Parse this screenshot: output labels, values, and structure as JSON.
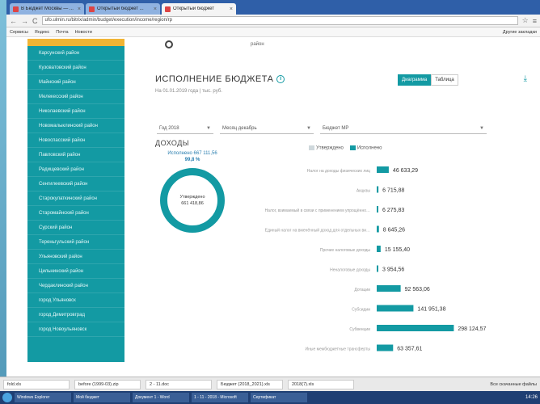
{
  "browser": {
    "tabs": [
      {
        "label": "В Бюджет Москвы — ...",
        "active": false
      },
      {
        "label": "Открытый бюджет ...",
        "active": false
      },
      {
        "label": "Открытый бюджет",
        "active": true
      }
    ],
    "url": "ufo.ulmin.ru/bitrix/admin/budget/execution/income/region/rp",
    "bookmarks": [
      "Сервисы",
      "Яндекс",
      "Почта",
      "Новости"
    ],
    "bookmarks_right": "Другие закладки"
  },
  "sidebar": {
    "items": [
      "Карсунский район",
      "Кузоватовский район",
      "Майнский район",
      "Мелекесский район",
      "Николаевский район",
      "Новомалыклинский район",
      "Новоспасский район",
      "Павловский район",
      "Радищевский район",
      "Сенгилеевский район",
      "Старокулаткинский район",
      "Старомайнский район",
      "Сурский район",
      "Тереньгульский район",
      "Ульяновский район",
      "Цильнинский район",
      "Чердаклинский район",
      "город Ульяновск",
      "город Димитровград",
      "город Новоульяновск"
    ]
  },
  "header": {
    "org_sub": "район",
    "title": "ИСПОЛНЕНИЕ БЮДЖЕТА",
    "subtitle": "На 01.01.2019 года | тыс. руб.",
    "view_chart": "Диаграмма",
    "view_table": "Таблица"
  },
  "filters": {
    "year": "Год 2018",
    "month": "Месяц декабрь",
    "budget": "Бюджет МР"
  },
  "section": "ДОХОДЫ",
  "legend": {
    "approved": "Утверждено",
    "executed": "Исполнено"
  },
  "colors": {
    "accent": "#139aa3",
    "sidebar_top": "#f1b434",
    "approved": "#cfd8dc"
  },
  "donut": {
    "executed_label": "Исполнено 667 111,56",
    "executed_pct": "99,8 %",
    "approved_label": "Утверждено",
    "approved_value": "661 418,86",
    "fraction": 0.998
  },
  "chart_data": {
    "type": "bar",
    "orientation": "horizontal",
    "categories": [
      "Налог на доходы физических лиц",
      "Акцизы",
      "Налог, взимаемый в связи с применением упрощённой системы налогообложения",
      "Единый налог на вменённый доход для отдельных видов деятельности",
      "Прочие налоговые доходы",
      "Неналоговые доходы",
      "Дотации",
      "Субсидии",
      "Субвенции",
      "Иные межбюджетные трансферты"
    ],
    "series": [
      {
        "name": "Исполнено",
        "values": [
          46633.29,
          6715.88,
          6275.83,
          8645.26,
          15155.4,
          3954.56,
          92563.06,
          141951.38,
          298124.57,
          63357.61
        ]
      }
    ],
    "value_labels": [
      "46 633,29",
      "6 715,88",
      "6 275,83",
      "8 645,26",
      "15 155,40",
      "3 954,56",
      "92 563,06",
      "141 951,38",
      "298 124,57",
      "63 357,61"
    ],
    "xlim": [
      0,
      300000
    ]
  },
  "status_bar": {
    "downloads": [
      "fold.xls",
      "before (1999-03).zip",
      "2 - 11.doc",
      "Бюджет (2018_2021).xls",
      "2018(7).xls"
    ],
    "show_all": "Все скачанные файлы"
  },
  "taskbar": {
    "items": [
      "Windows Explorer",
      "Мой бюджет",
      "Документ 1 - Word",
      "1 - 11 - 2018 - Microsoft",
      "Сертификат"
    ],
    "clock": "14:26"
  }
}
